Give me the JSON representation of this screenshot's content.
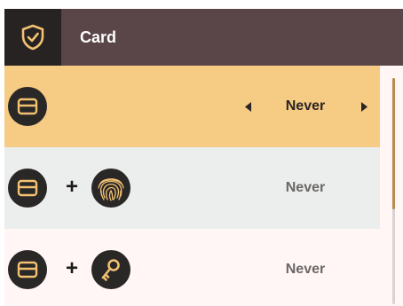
{
  "header": {
    "title": "Card",
    "icon": "shield-check-icon"
  },
  "rows": [
    {
      "icons": [
        "card-icon"
      ],
      "value": "Never",
      "selected": true
    },
    {
      "icons": [
        "card-icon",
        "fingerprint-icon"
      ],
      "value": "Never",
      "selected": false
    },
    {
      "icons": [
        "card-icon",
        "key-icon"
      ],
      "value": "Never",
      "selected": false
    }
  ],
  "plus_symbol": "+",
  "colors": {
    "header_bg": "#5a4548",
    "header_icon_bg": "#272323",
    "selected_row": "#f6cb83",
    "row_alt": "#ebeeec",
    "row_light": "#fff6f5",
    "icon_circle": "#2a2727",
    "icon_gold": "#f2c271",
    "scroll_thumb": "#b88a4c"
  }
}
